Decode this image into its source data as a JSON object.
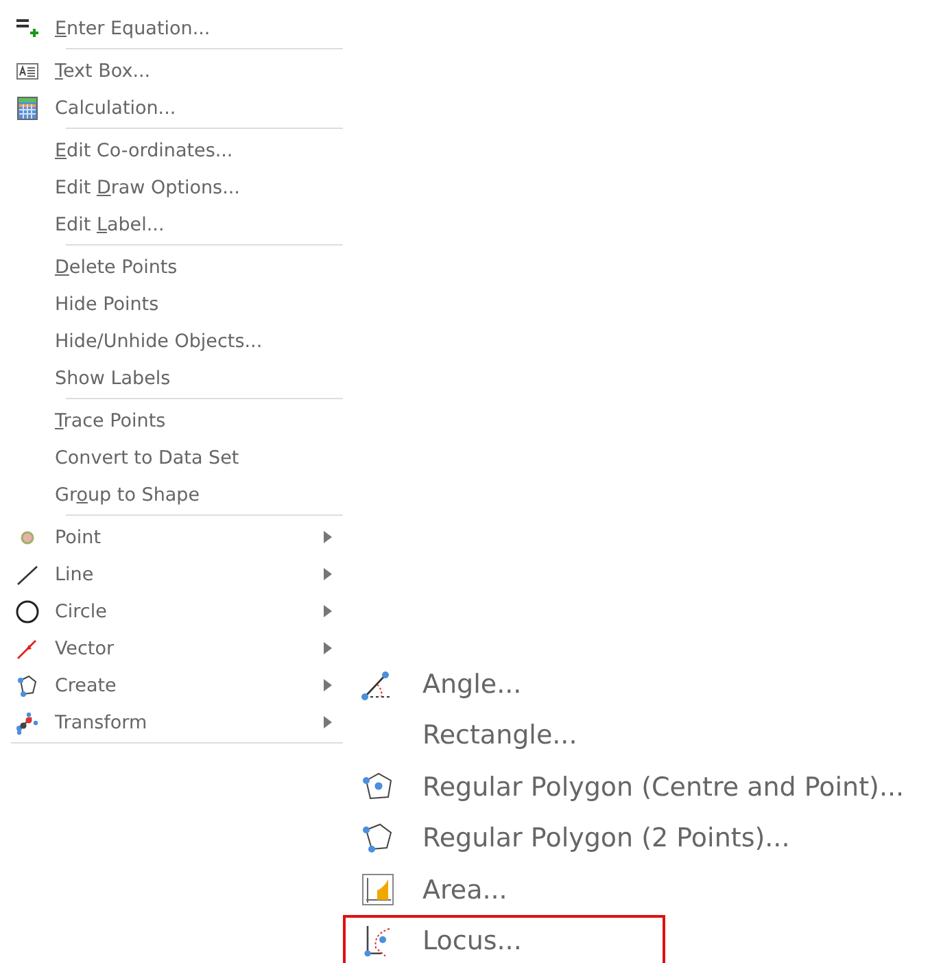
{
  "menu": {
    "groups": [
      [
        {
          "mnemonic": "E",
          "label_after": "nter Equation...",
          "submenu": false
        }
      ],
      [
        {
          "mnemonic": "T",
          "label_after": "ext Box...",
          "submenu": false
        },
        {
          "label": "Calculation...",
          "submenu": false
        }
      ],
      [
        {
          "mnemonic": "E",
          "label_after": "dit Co-ordinates...",
          "submenu": false
        },
        {
          "label_before": "Edit ",
          "mnemonic": "D",
          "label_after": "raw Options...",
          "submenu": false
        },
        {
          "label_before": "Edit ",
          "mnemonic": "L",
          "label_after": "abel...",
          "submenu": false
        }
      ],
      [
        {
          "mnemonic": "D",
          "label_after": "elete Points",
          "submenu": false
        },
        {
          "label": "Hide Points",
          "submenu": false
        },
        {
          "label": "Hide/Unhide Objects...",
          "submenu": false
        },
        {
          "label": "Show Labels",
          "submenu": false
        }
      ],
      [
        {
          "mnemonic": "T",
          "label_after": "race Points",
          "submenu": false
        },
        {
          "label": "Convert to Data Set",
          "submenu": false
        },
        {
          "label_before": "Gr",
          "mnemonic": "o",
          "label_after": "up to Shape",
          "submenu": false
        }
      ],
      [
        {
          "label": "Point",
          "submenu": true
        },
        {
          "label": "Line",
          "submenu": true
        },
        {
          "label": "Circle",
          "submenu": true
        },
        {
          "label": "Vector",
          "submenu": true
        },
        {
          "label": "Create",
          "submenu": true
        },
        {
          "label": "Transform",
          "submenu": true
        }
      ]
    ]
  },
  "submenu": {
    "items": [
      {
        "label": "Angle...",
        "highlighted": false
      },
      {
        "label": "Rectangle...",
        "highlighted": false
      },
      {
        "label": "Regular Polygon (Centre and Point)...",
        "highlighted": false
      },
      {
        "label": "Regular Polygon (2 Points)...",
        "highlighted": false
      },
      {
        "label": "Area...",
        "highlighted": false
      },
      {
        "label": "Locus...",
        "highlighted": true
      }
    ]
  }
}
